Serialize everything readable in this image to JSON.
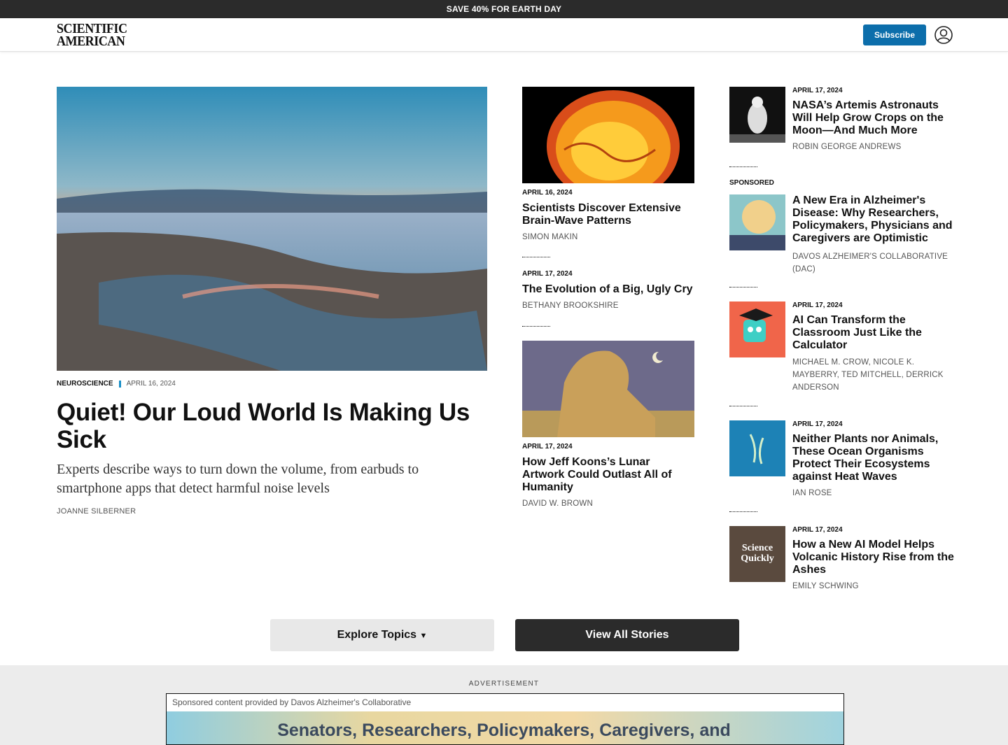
{
  "promo": {
    "text": "SAVE 40% FOR EARTH DAY"
  },
  "header": {
    "logo_line1": "SCIENTIFIC",
    "logo_line2": "AMERICAN",
    "subscribe_label": "Subscribe",
    "account_icon": "user-circle-icon"
  },
  "hero": {
    "category": "NEUROSCIENCE",
    "date": "APRIL 16, 2024",
    "title": "Quiet! Our Loud World Is Making Us Sick",
    "dek": "Experts describe ways to turn down the volume, from earbuds to smartphone apps that detect harmful noise levels",
    "author": "JOANNE SILBERNER"
  },
  "middle": [
    {
      "date": "APRIL 16, 2024",
      "title": "Scientists Discover Extensive Brain-Wave Patterns",
      "author": "SIMON MAKIN"
    },
    {
      "date": "APRIL 17, 2024",
      "title": "The Evolution of a Big, Ugly Cry",
      "author": "BETHANY BROOKSHIRE"
    },
    {
      "date": "APRIL 17, 2024",
      "title": "How Jeff Koons’s Lunar Artwork Could Outlast All of Humanity",
      "author": "DAVID W. BROWN"
    }
  ],
  "right": [
    {
      "date": "APRIL 17, 2024",
      "title": "NASA’s Artemis Astronauts Will Help Grow Crops on the Moon—And Much More",
      "author": "ROBIN GEORGE ANDREWS"
    },
    {
      "label": "SPONSORED",
      "title": "A New Era in Alzheimer's Disease: Why Researchers, Policymakers, Physicians and Caregivers are Optimistic",
      "author": "DAVOS ALZHEIMER'S COLLABORATIVE (DAC)"
    },
    {
      "date": "APRIL 17, 2024",
      "title": "AI Can Transform the Classroom Just Like the Calculator",
      "author": "MICHAEL M. CROW, NICOLE K. MAYBERRY, TED MITCHELL, DERRICK ANDERSON"
    },
    {
      "date": "APRIL 17, 2024",
      "title": "Neither Plants nor Animals, These Ocean Organisms Protect Their Ecosystems against Heat Waves",
      "author": "IAN ROSE"
    },
    {
      "date": "APRIL 17, 2024",
      "title": "How a New AI Model Helps Volcanic History Rise from the Ashes",
      "author": "EMILY SCHWING",
      "thumb_text": "Science Quickly"
    }
  ],
  "buttons": {
    "explore": "Explore Topics",
    "view_all": "View All Stories"
  },
  "ad": {
    "label": "ADVERTISEMENT",
    "sponsor": "Sponsored content provided by Davos Alzheimer's Collaborative",
    "headline": "Senators, Researchers, Policymakers, Caregivers, and"
  },
  "colors": {
    "accent": "#0c6eab",
    "dark": "#2b2b2b",
    "category_bar": "#1a8fc7"
  }
}
